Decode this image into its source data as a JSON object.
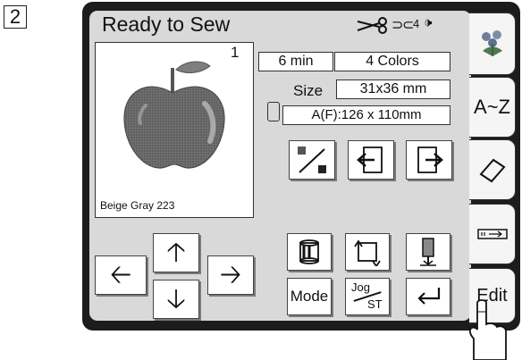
{
  "step_number": "2",
  "screen": {
    "title": "Ready to Sew",
    "preview": {
      "number": "1",
      "thread_name": "Beige Gray 223"
    },
    "info": {
      "time": "6 min",
      "colors": "4 Colors",
      "size_label": "Size",
      "size_value": "31x36 mm",
      "hoop_value": "A(F):126 x 110mm"
    },
    "buttons": {
      "mode_label": "Mode",
      "jog_label": "Jog",
      "st_label": "ST"
    },
    "tabs": {
      "az_label": "A~Z",
      "edit_label": "Edit"
    },
    "status": {
      "thread_count": "4"
    }
  }
}
